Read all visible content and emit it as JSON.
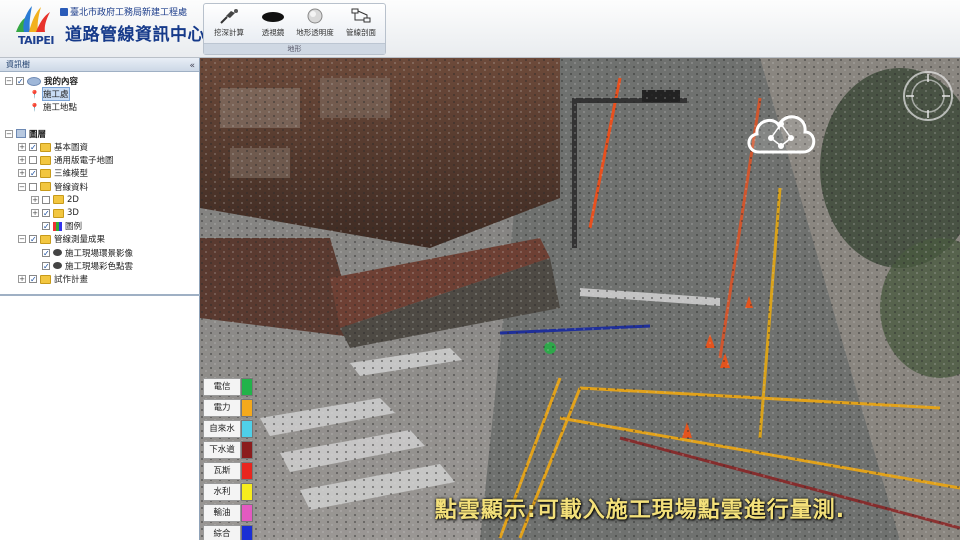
{
  "header": {
    "logo_text": "TAIPEI",
    "agency": "臺北市政府工務局新建工程處",
    "center_name": "道路管線資訊中心"
  },
  "toolbar": {
    "tools": [
      {
        "label": "挖深計算",
        "icon": "shovel-icon"
      },
      {
        "label": "透視鏡",
        "icon": "lens-icon"
      },
      {
        "label": "地形透明度",
        "icon": "transparency-icon"
      },
      {
        "label": "管線剖面",
        "icon": "pipe-section-icon"
      }
    ],
    "group_label": "地形"
  },
  "panel": {
    "title": "資訊樹",
    "tree": [
      {
        "label": "我的內容",
        "level": 0,
        "expander": "minus",
        "checked": true,
        "icon": "globe-icon",
        "bold": true
      },
      {
        "label": "施工處",
        "level": 1,
        "expander": "",
        "checked": null,
        "icon": "pin-icon",
        "selected": true
      },
      {
        "label": "施工地點",
        "level": 1,
        "expander": "",
        "checked": null,
        "icon": "pin-icon"
      },
      {
        "label": "",
        "level": 0,
        "expander": "",
        "checked": null,
        "icon": "",
        "spacer": true
      },
      {
        "label": "圖層",
        "level": 0,
        "expander": "minus",
        "checked": null,
        "icon": "layers-icon",
        "bold": true
      },
      {
        "label": "基本圖資",
        "level": 1,
        "expander": "plus",
        "checked": true,
        "icon": "folder-icon"
      },
      {
        "label": "通用版電子地圖",
        "level": 1,
        "expander": "plus",
        "checked": false,
        "icon": "folder-icon"
      },
      {
        "label": "三維模型",
        "level": 1,
        "expander": "plus",
        "checked": true,
        "icon": "folder-icon"
      },
      {
        "label": "管線資料",
        "level": 1,
        "expander": "minus",
        "checked": false,
        "icon": "folder-icon"
      },
      {
        "label": "2D",
        "level": 2,
        "expander": "plus",
        "checked": false,
        "icon": "folder-icon"
      },
      {
        "label": "3D",
        "level": 2,
        "expander": "plus",
        "checked": true,
        "icon": "folder-icon"
      },
      {
        "label": "圖例",
        "level": 2,
        "expander": "",
        "checked": true,
        "icon": "legend-icon"
      },
      {
        "label": "管線測量成果",
        "level": 1,
        "expander": "minus",
        "checked": true,
        "icon": "folder-icon"
      },
      {
        "label": "施工現場環景影像",
        "level": 2,
        "expander": "",
        "checked": true,
        "icon": "cloud-icon"
      },
      {
        "label": "施工現場彩色點雲",
        "level": 2,
        "expander": "",
        "checked": true,
        "icon": "cloud-icon"
      },
      {
        "label": "試作計畫",
        "level": 1,
        "expander": "plus",
        "checked": true,
        "icon": "folder-icon"
      }
    ]
  },
  "legend": [
    {
      "label": "電信",
      "color": "#22b34a"
    },
    {
      "label": "電力",
      "color": "#f4a91c"
    },
    {
      "label": "自來水",
      "color": "#4fd0e8"
    },
    {
      "label": "下水道",
      "color": "#8b1d1d"
    },
    {
      "label": "瓦斯",
      "color": "#e8261f"
    },
    {
      "label": "水利",
      "color": "#f7ec1d"
    },
    {
      "label": "輸油",
      "color": "#e35ac0"
    },
    {
      "label": "綜合",
      "color": "#1a2fd4"
    }
  ],
  "caption": "點雲顯示:可載入施工現場點雲進行量測.",
  "colors": {
    "header_text": "#163a8a",
    "caption": "#f3e07a"
  }
}
